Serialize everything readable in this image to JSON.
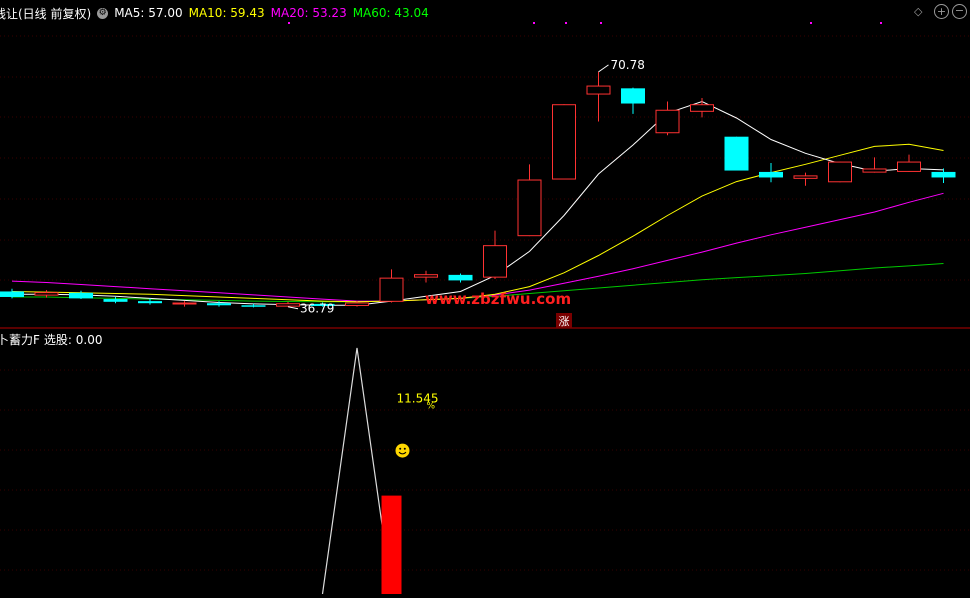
{
  "main_header": {
    "title": "线让(日线 前复权)",
    "ma_items": [
      {
        "label": "MA5: 57.00",
        "color": "#ffffff"
      },
      {
        "label": "MA10: 59.43",
        "color": "#ffff00"
      },
      {
        "label": "MA20: 53.23",
        "color": "#ff00ff"
      },
      {
        "label": "MA60: 43.04",
        "color": "#00ff00"
      }
    ],
    "settings_icon": "gear-circle-icon",
    "zoom_in_icon": "plus-circle-icon",
    "zoom_out_icon": "minus-circle-icon",
    "diamond_icon": "diamond-icon"
  },
  "sub_header": {
    "title": "卜蓄力F",
    "value_label": "选股: 0.00"
  },
  "watermark": "www.zbzfwu.com",
  "colors": {
    "up": "#ff3232",
    "down": "#00ffff",
    "ma5": "#ffffff",
    "ma10": "#ffff00",
    "ma20": "#ff00ff",
    "ma60": "#00c800",
    "grid": "#3a0000",
    "axis_line": "#b40000",
    "watermark": "#ff1f1f",
    "indicator_line": "#dcdcdc",
    "indicator_bar": "#ff0000",
    "pct_label": "#ffff00"
  },
  "chart_data": [
    {
      "type": "candlestick",
      "title": "",
      "ylim": [
        34,
        78
      ],
      "candles": [
        {
          "o": 39.0,
          "h": 39.4,
          "l": 38.0,
          "c": 38.2
        },
        {
          "o": 38.4,
          "h": 39.2,
          "l": 38.1,
          "c": 38.9
        },
        {
          "o": 38.8,
          "h": 39.1,
          "l": 37.9,
          "c": 38.0
        },
        {
          "o": 37.9,
          "h": 38.2,
          "l": 37.3,
          "c": 37.5
        },
        {
          "o": 37.6,
          "h": 38.0,
          "l": 37.1,
          "c": 37.3
        },
        {
          "o": 37.2,
          "h": 37.6,
          "l": 36.8,
          "c": 37.4
        },
        {
          "o": 37.3,
          "h": 37.6,
          "l": 36.8,
          "c": 37.0
        },
        {
          "o": 37.0,
          "h": 37.2,
          "l": 36.7,
          "c": 36.8
        },
        {
          "o": 36.8,
          "h": 37.5,
          "l": 36.79,
          "c": 37.3
        },
        {
          "o": 37.2,
          "h": 37.4,
          "l": 36.8,
          "c": 36.9
        },
        {
          "o": 36.9,
          "h": 37.6,
          "l": 36.8,
          "c": 37.4
        },
        {
          "o": 37.5,
          "h": 42.2,
          "l": 37.4,
          "c": 41.0
        },
        {
          "o": 41.0,
          "h": 42.0,
          "l": 40.3,
          "c": 41.5
        },
        {
          "o": 41.4,
          "h": 41.6,
          "l": 40.3,
          "c": 40.6
        },
        {
          "o": 41.0,
          "h": 47.8,
          "l": 40.8,
          "c": 45.7
        },
        {
          "o": 47.0,
          "h": 57.4,
          "l": 47.0,
          "c": 55.2
        },
        {
          "o": 55.2,
          "h": 66.1,
          "l": 55.2,
          "c": 66.1
        },
        {
          "o": 67.5,
          "h": 70.78,
          "l": 63.6,
          "c": 68.8
        },
        {
          "o": 68.4,
          "h": 68.5,
          "l": 64.7,
          "c": 66.2
        },
        {
          "o": 61.9,
          "h": 66.5,
          "l": 61.6,
          "c": 65.3
        },
        {
          "o": 65.0,
          "h": 67.0,
          "l": 64.2,
          "c": 66.1
        },
        {
          "o": 61.4,
          "h": 61.4,
          "l": 56.5,
          "c": 56.5
        },
        {
          "o": 56.3,
          "h": 57.6,
          "l": 54.8,
          "c": 55.5
        },
        {
          "o": 55.3,
          "h": 56.2,
          "l": 54.3,
          "c": 55.8
        },
        {
          "o": 54.8,
          "h": 57.8,
          "l": 54.8,
          "c": 57.8
        },
        {
          "o": 56.2,
          "h": 58.4,
          "l": 56.2,
          "c": 56.8
        },
        {
          "o": 56.3,
          "h": 58.8,
          "l": 56.3,
          "c": 57.8
        },
        {
          "o": 56.3,
          "h": 56.8,
          "l": 54.7,
          "c": 55.5
        }
      ],
      "ma5": [
        38.6,
        38.6,
        38.5,
        38.3,
        38.0,
        37.7,
        37.4,
        37.2,
        37.1,
        37.0,
        37.0,
        37.6,
        38.3,
        39.0,
        41.3,
        44.8,
        50.0,
        56.0,
        60.2,
        64.8,
        66.5,
        64.1,
        61.0,
        59.0,
        57.5,
        56.4,
        56.8,
        56.6
      ],
      "ma10": [
        39.0,
        38.9,
        38.8,
        38.7,
        38.6,
        38.4,
        38.2,
        38.0,
        37.8,
        37.6,
        37.5,
        37.6,
        37.8,
        38.0,
        38.6,
        39.7,
        41.7,
        44.2,
        47.0,
        50.0,
        52.8,
        54.9,
        56.2,
        57.4,
        58.7,
        60.0,
        60.3,
        59.4
      ],
      "ma20": [
        40.5,
        40.3,
        40.0,
        39.7,
        39.4,
        39.1,
        38.8,
        38.5,
        38.2,
        37.9,
        37.6,
        37.6,
        37.8,
        38.0,
        38.5,
        39.2,
        40.2,
        41.2,
        42.3,
        43.5,
        44.7,
        46.0,
        47.2,
        48.3,
        49.4,
        50.5,
        51.9,
        53.2
      ],
      "ma60": [
        38.2,
        38.2,
        38.1,
        38.0,
        37.9,
        37.8,
        37.7,
        37.6,
        37.55,
        37.5,
        37.5,
        37.6,
        37.8,
        38.0,
        38.3,
        38.7,
        39.1,
        39.5,
        39.9,
        40.3,
        40.7,
        41.0,
        41.3,
        41.6,
        42.0,
        42.4,
        42.7,
        43.04
      ],
      "annotations": [
        {
          "label": "70.78",
          "candle_index": 17,
          "price": 70.78,
          "kind": "high"
        },
        {
          "label": "36.79",
          "candle_index": 8,
          "price": 36.79,
          "kind": "low"
        }
      ],
      "signal_label": "涨",
      "signal_candle_index": 16
    },
    {
      "type": "line",
      "title": "卜蓄力F",
      "ylim": [
        0,
        100
      ],
      "series": [
        {
          "values": [
            null,
            null,
            null,
            null,
            null,
            null,
            null,
            null,
            null,
            0,
            100,
            1,
            null,
            null,
            null,
            null,
            null,
            null,
            null,
            null,
            null,
            null,
            null,
            null,
            null,
            null,
            null,
            null
          ]
        }
      ],
      "bar": {
        "candle_index": 11,
        "value": 40
      },
      "pct_label": "11.545",
      "pct_unit": "%",
      "icon": "smiley-icon"
    }
  ]
}
